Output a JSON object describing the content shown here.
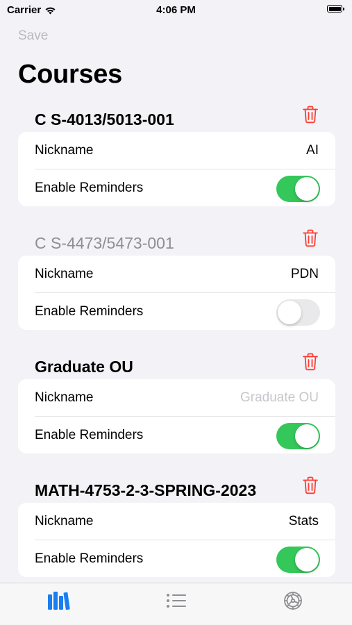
{
  "status_bar": {
    "carrier": "Carrier",
    "time": "4:06 PM"
  },
  "nav": {
    "save_label": "Save",
    "title": "Courses"
  },
  "courses": [
    {
      "title": "C S-4013/5013-001",
      "title_muted": false,
      "nickname_label": "Nickname",
      "nickname_value": "AI",
      "nickname_placeholder": "",
      "reminders_label": "Enable Reminders",
      "reminders_enabled": true
    },
    {
      "title": "C S-4473/5473-001",
      "title_muted": true,
      "nickname_label": "Nickname",
      "nickname_value": "PDN",
      "nickname_placeholder": "",
      "reminders_label": "Enable Reminders",
      "reminders_enabled": false
    },
    {
      "title": "Graduate OU",
      "title_muted": false,
      "nickname_label": "Nickname",
      "nickname_value": "",
      "nickname_placeholder": "Graduate OU",
      "reminders_label": "Enable Reminders",
      "reminders_enabled": true
    },
    {
      "title": "MATH-4753-2-3-SPRING-2023",
      "title_muted": false,
      "nickname_label": "Nickname",
      "nickname_value": "Stats",
      "nickname_placeholder": "",
      "reminders_label": "Enable Reminders",
      "reminders_enabled": true
    }
  ],
  "tab_bar": {
    "tabs": [
      {
        "icon": "books-icon",
        "selected": true
      },
      {
        "icon": "list-icon",
        "selected": false
      },
      {
        "icon": "gear-icon",
        "selected": false
      }
    ]
  },
  "colors": {
    "accent": "#1a7df0",
    "delete": "#ff3b30",
    "toggle_on": "#34c759",
    "toggle_off": "#e9e9eb",
    "placeholder": "#c7c7cc",
    "background": "#f2f2f7"
  }
}
